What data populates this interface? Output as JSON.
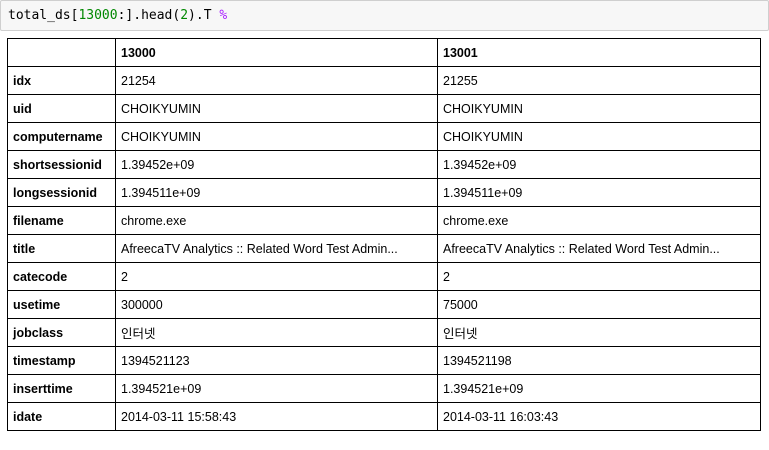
{
  "code_cell": {
    "prefix": "total_ds[",
    "number1": "13000",
    "middle": ":].head(",
    "number2": "2",
    "suffix": ").T",
    "trailing_symbol": "%"
  },
  "table": {
    "columns": [
      "",
      "13000",
      "13001"
    ],
    "rows": [
      {
        "index": "idx",
        "values": [
          "21254",
          "21255"
        ]
      },
      {
        "index": "uid",
        "values": [
          "CHOIKYUMIN",
          "CHOIKYUMIN"
        ]
      },
      {
        "index": "computername",
        "values": [
          "CHOIKYUMIN",
          "CHOIKYUMIN"
        ]
      },
      {
        "index": "shortsessionid",
        "values": [
          "1.39452e+09",
          "1.39452e+09"
        ]
      },
      {
        "index": "longsessionid",
        "values": [
          "1.394511e+09",
          "1.394511e+09"
        ]
      },
      {
        "index": "filename",
        "values": [
          "chrome.exe",
          "chrome.exe"
        ]
      },
      {
        "index": "title",
        "values": [
          "AfreecaTV Analytics :: Related Word Test Admin...",
          "AfreecaTV Analytics :: Related Word Test Admin..."
        ]
      },
      {
        "index": "catecode",
        "values": [
          "2",
          "2"
        ]
      },
      {
        "index": "usetime",
        "values": [
          "300000",
          "75000"
        ]
      },
      {
        "index": "jobclass",
        "values": [
          "인터넷",
          "인터넷"
        ]
      },
      {
        "index": "timestamp",
        "values": [
          "1394521123",
          "1394521198"
        ]
      },
      {
        "index": "inserttime",
        "values": [
          "1.394521e+09",
          "1.394521e+09"
        ]
      },
      {
        "index": "idate",
        "values": [
          "2014-03-11 15:58:43",
          "2014-03-11 16:03:43"
        ]
      }
    ]
  }
}
